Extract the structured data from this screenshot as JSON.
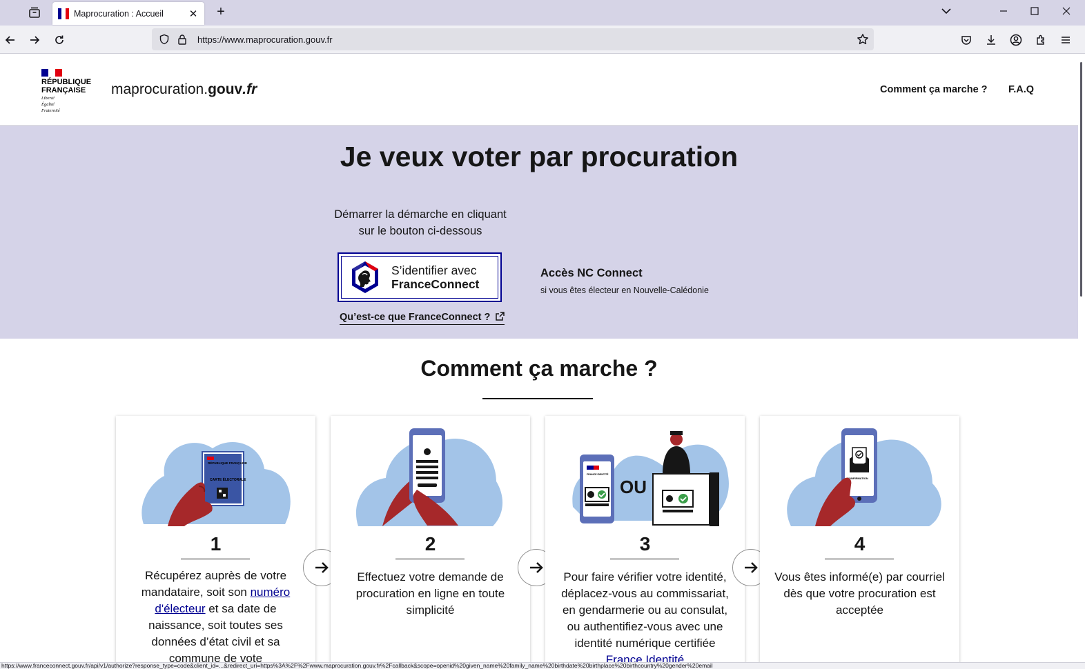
{
  "browser": {
    "tab_title": "Maprocuration : Accueil",
    "url": "https://www.maprocuration.gouv.fr",
    "status_url": "https://www.franceconnect.gouv.fr/api/v1/authorize?response_type=code&client_id=...&redirect_uri=https%3A%2F%2Fwww.maprocuration.gouv.fr%2Fcallback&scope=openid%20given_name%20family_name%20birthdate%20birthplace%20birthcountry%20gender%20email"
  },
  "header": {
    "logo_lines": [
      "RÉPUBLIQUE",
      "FRANÇAISE"
    ],
    "motto_lines": [
      "Liberté",
      "Égalité",
      "Fraternité"
    ],
    "site_name_main": "maprocuration.",
    "site_name_gouv": "gouv",
    "site_name_fr": ".fr",
    "nav": {
      "how_it_works": "Comment ça marche ?",
      "faq": "F.A.Q"
    }
  },
  "hero": {
    "title": "Je veux voter par procuration",
    "subtitle_line1": "Démarrer la démarche en cliquant",
    "subtitle_line2": "sur le bouton ci-dessous",
    "fc_button_line1": "S’identifier avec",
    "fc_button_line2": "FranceConnect",
    "fc_link": "Qu’est-ce que FranceConnect ?",
    "nc_title": "Accès NC Connect",
    "nc_sub": "si vous êtes électeur en Nouvelle-Calédonie"
  },
  "how": {
    "title": "Comment ça marche ?",
    "steps": [
      {
        "num": "1",
        "text_before": "Récupérez auprès de votre mandataire, soit son ",
        "link": "numéro d'électeur",
        "text_after": " et sa date de naissance, soit toutes ses données d’état civil et sa commune de vote",
        "card_label_1": "RÉPUBLIQUE FRANÇAISE",
        "card_label_2": "CARTE ÉLECTORALE"
      },
      {
        "num": "2",
        "text": "Effectuez votre demande de procuration en ligne en toute simplicité"
      },
      {
        "num": "3",
        "text": "Pour faire vérifier votre identité, déplacez-vous au commissariat, en gendarmerie ou au consulat, ou authentifiez-vous avec une identité numérique certifiée ",
        "link": "France Identité",
        "ou": "OU",
        "phone_label": "FRANCE IDENTITÉ"
      },
      {
        "num": "4",
        "text": "Vous êtes informé(e) par courriel dès que votre procuration est acceptée",
        "phone_label": "CONFIRMATION"
      }
    ]
  },
  "colors": {
    "hero_bg": "#d5d3e8",
    "blue_france": "#000091",
    "red_marianne": "#e1000f",
    "illus_blue": "#a3c4e8",
    "illus_red": "#a6282a"
  },
  "icons": {
    "tab_list": "tab-list-icon",
    "back": "arrow-left-icon",
    "forward": "arrow-right-icon",
    "reload": "reload-icon",
    "shield": "shield-icon",
    "lock": "lock-icon",
    "star": "star-icon",
    "pocket": "pocket-icon",
    "download": "download-icon",
    "account": "account-icon",
    "extensions": "extensions-icon",
    "menu": "menu-icon",
    "external": "external-link-icon",
    "step_arrow": "arrow-right-icon"
  }
}
